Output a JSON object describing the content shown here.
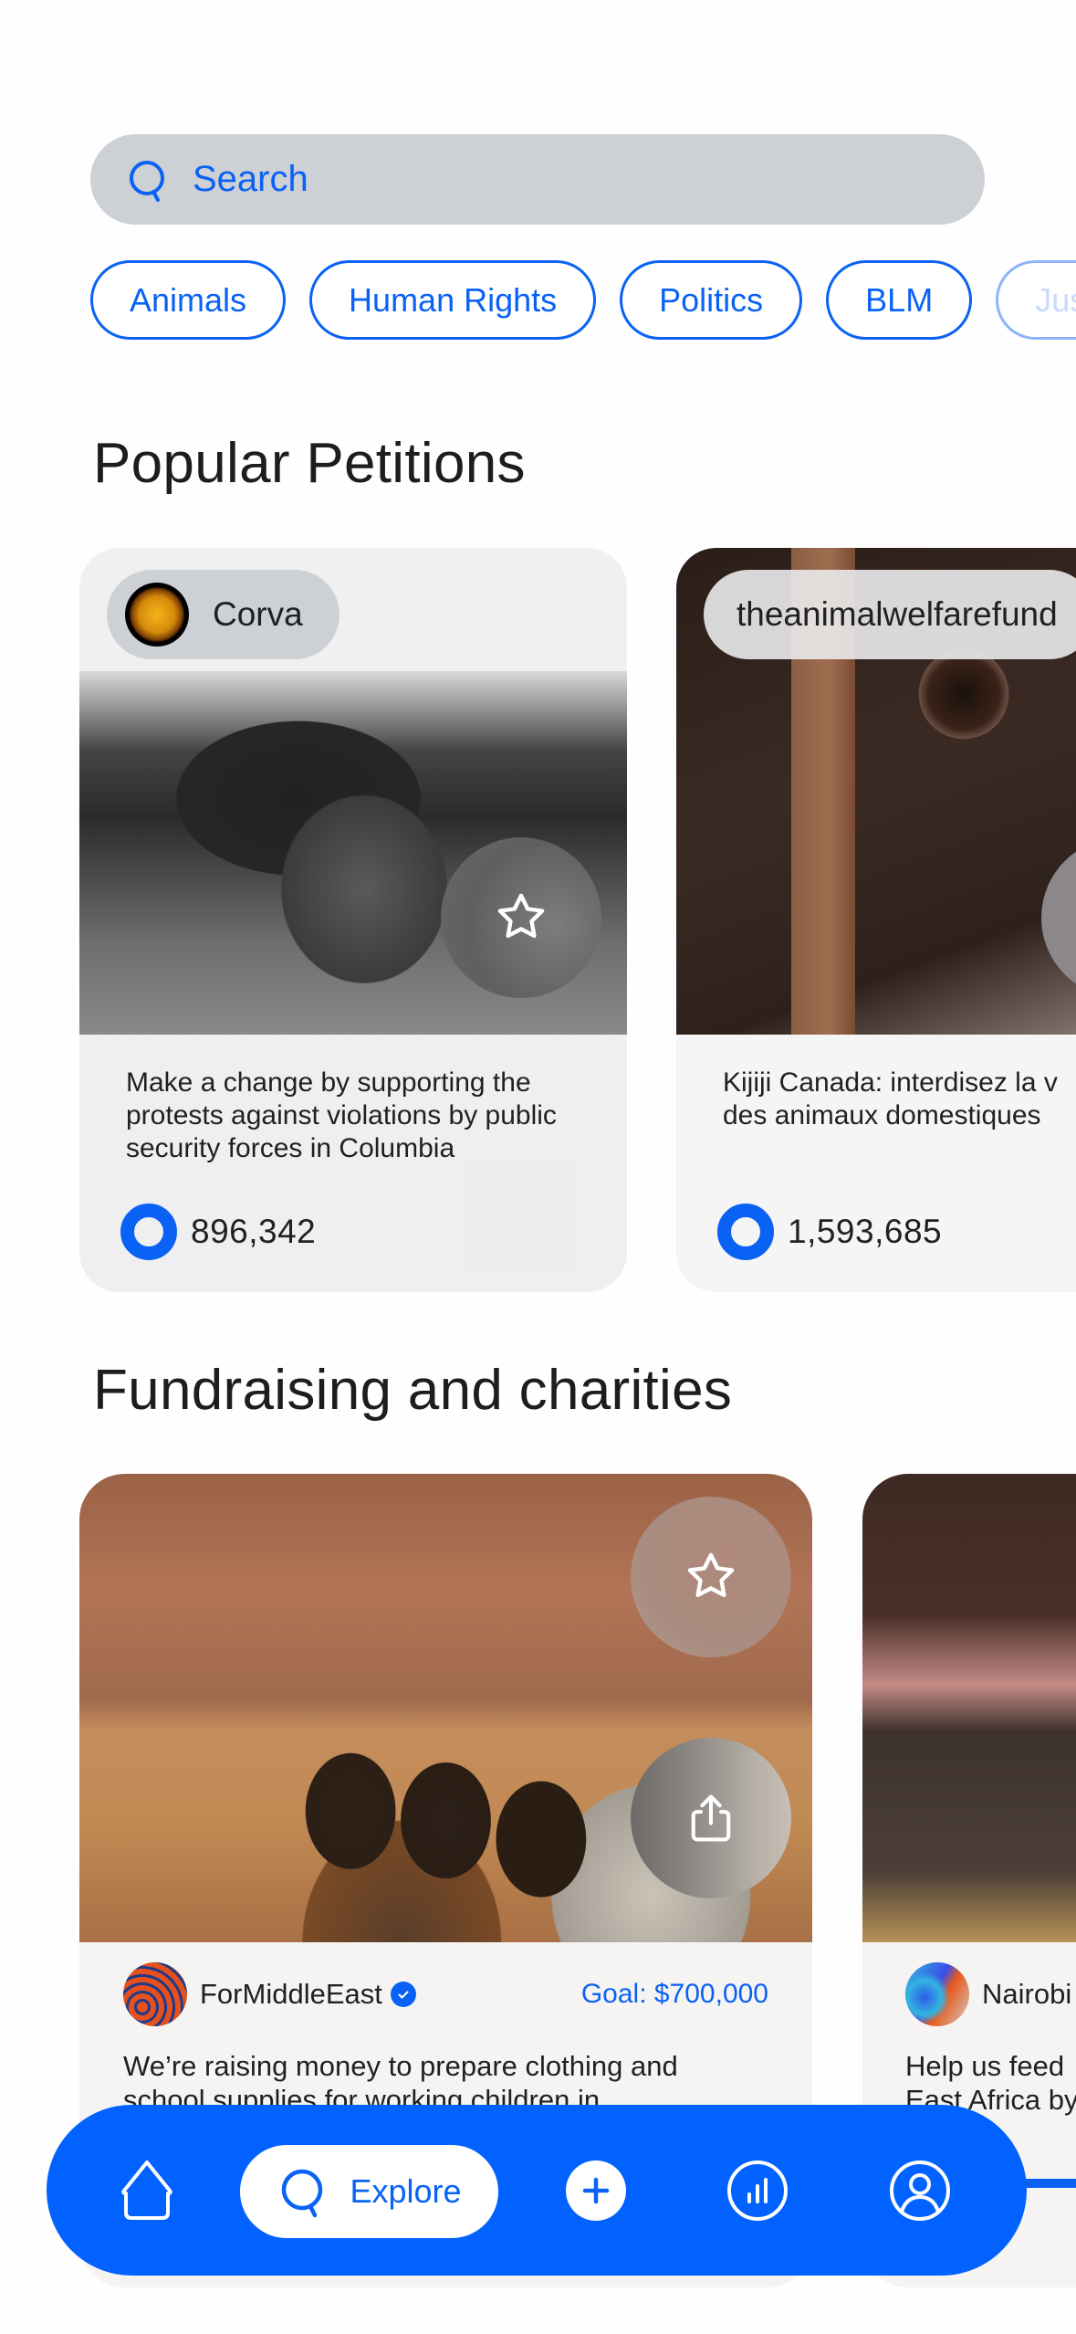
{
  "search": {
    "placeholder": "Search",
    "icon": "search-icon"
  },
  "categories": [
    "Animals",
    "Human Rights",
    "Politics",
    "BLM",
    "Jus"
  ],
  "popular_petitions": {
    "title": "Popular Petitions",
    "cards": [
      {
        "author": "Corva",
        "text": "Make a change by supporting the protests against violations by public security forces in Columbia",
        "signatures": "896,342",
        "icon": "star-icon"
      },
      {
        "author": "theanimalwelfarefund",
        "text_line1": "Kijiji Canada: interdisez la v",
        "text_line2": "des animaux domestiques",
        "signatures": "1,593,685",
        "icon": "star-icon"
      }
    ]
  },
  "fundraising": {
    "title": "Fundraising and charities",
    "cards": [
      {
        "org": "ForMiddleEast",
        "verified": true,
        "goal": "Goal: $700,000",
        "text_line1": "We’re raising money to prepare clothing and",
        "text_line2": "school supplies for working children in"
      },
      {
        "org": "Nairobi",
        "text_line1": "Help us feed",
        "text_line2": "East Africa by"
      }
    ]
  },
  "nav": {
    "items": [
      {
        "name": "home",
        "icon": "home-icon"
      },
      {
        "name": "explore",
        "label": "Explore",
        "icon": "search-icon",
        "active": true
      },
      {
        "name": "add",
        "icon": "plus-icon"
      },
      {
        "name": "stats",
        "icon": "chart-icon"
      },
      {
        "name": "profile",
        "icon": "profile-icon"
      }
    ]
  },
  "colors": {
    "accent": "#0A62F5",
    "nav_bg": "#0262FF",
    "search_bg": "#CDD0D5",
    "text": "#1C1D1F"
  }
}
